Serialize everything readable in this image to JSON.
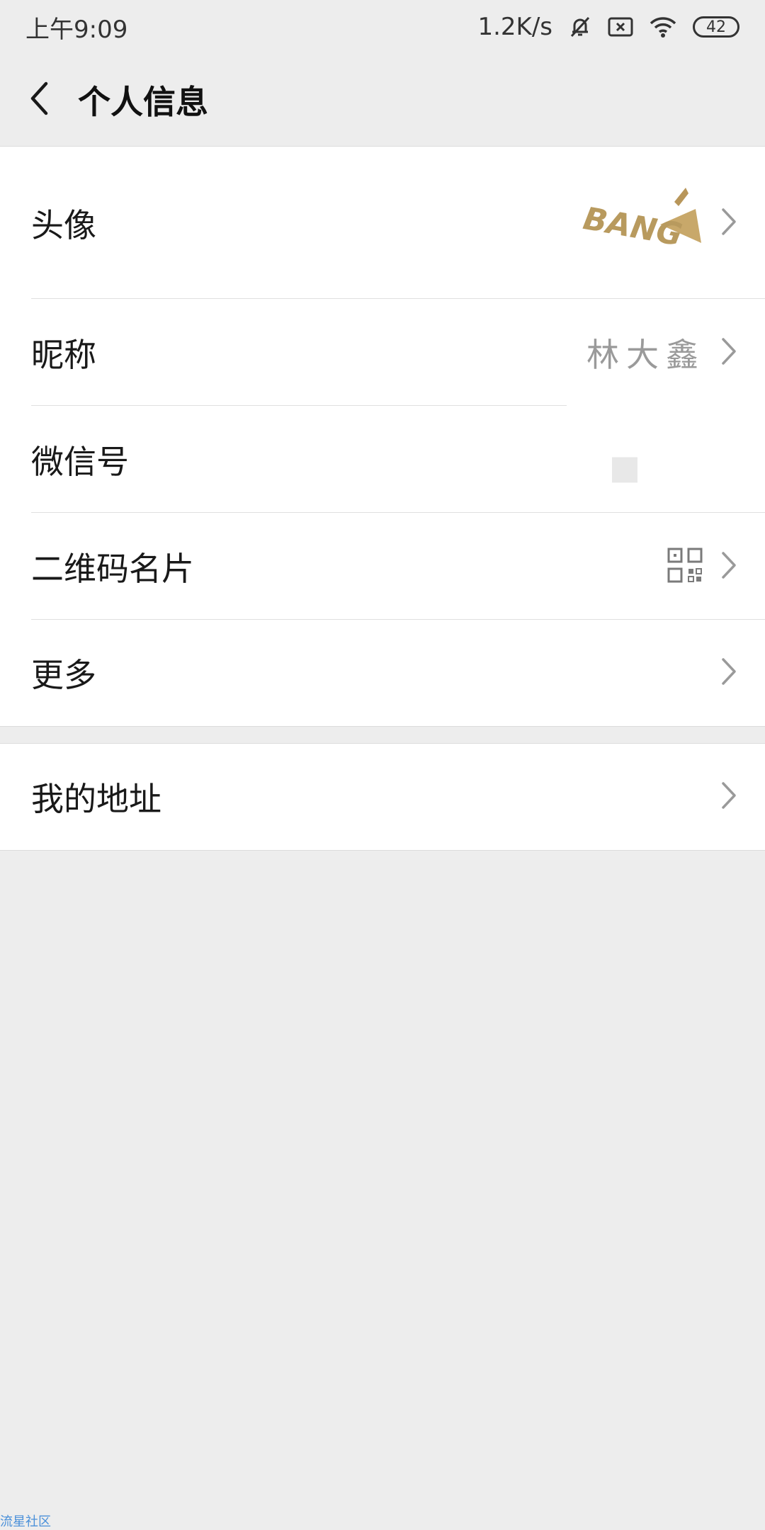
{
  "status_bar": {
    "time": "上午9:09",
    "network_speed": "1.2K/s",
    "battery_level": "42",
    "icons": [
      "mute-icon",
      "sim-off-icon",
      "wifi-icon",
      "battery-icon"
    ]
  },
  "header": {
    "title": "个人信息",
    "back_icon": "back-arrow-icon"
  },
  "profile": {
    "avatar_label": "头像",
    "avatar_text": "BANG",
    "nickname_label": "昵称",
    "nickname_value": "林大鑫",
    "wechat_id_label": "微信号",
    "qr_label": "二维码名片",
    "more_label": "更多"
  },
  "address": {
    "label": "我的地址"
  },
  "watermark": "流星社区",
  "colors": {
    "background": "#ededed",
    "card": "#ffffff",
    "text": "#191919",
    "secondary_text": "#9a9a9a"
  }
}
